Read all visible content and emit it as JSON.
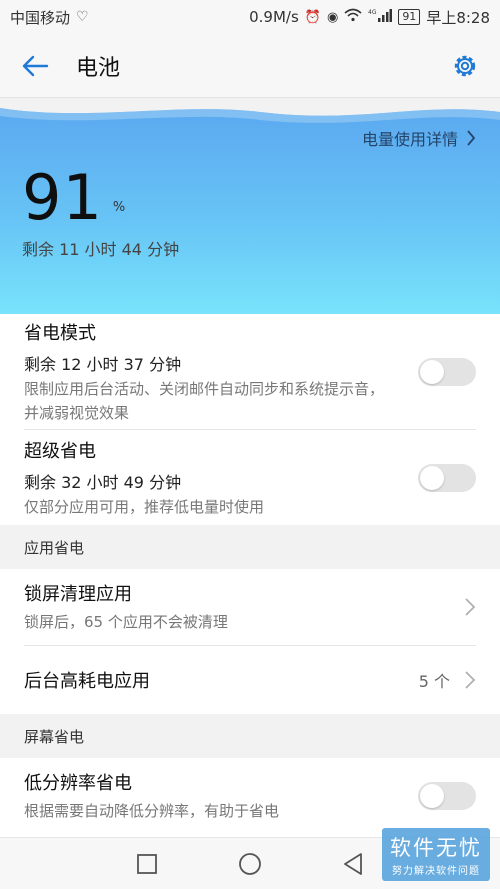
{
  "status_bar": {
    "carrier": "中国移动",
    "speed": "0.9M/s",
    "signal_label": "4G",
    "battery": "91",
    "time": "早上8:28"
  },
  "header": {
    "title": "电池"
  },
  "hero": {
    "detail_link": "电量使用详情",
    "percent": "91",
    "percent_sign": "%",
    "remaining": "剩余 11 小时 44 分钟"
  },
  "modes": [
    {
      "title": "省电模式",
      "remaining": "剩余 12 小时 37 分钟",
      "description": "限制应用后台活动、关闭邮件自动同步和系统提示音，并减弱视觉效果",
      "enabled": false
    },
    {
      "title": "超级省电",
      "remaining": "剩余 32 小时 49 分钟",
      "description": "仅部分应用可用，推荐低电量时使用",
      "enabled": false
    }
  ],
  "app_saving": {
    "section_title": "应用省电",
    "items": [
      {
        "title": "锁屏清理应用",
        "description": "锁屏后，65 个应用不会被清理"
      },
      {
        "title": "后台高耗电应用",
        "value": "5 个"
      }
    ]
  },
  "screen_saving": {
    "section_title": "屏幕省电",
    "items": [
      {
        "title": "低分辨率省电",
        "description": "根据需要自动降低分辨率，有助于省电",
        "enabled": false
      }
    ]
  },
  "watermark": {
    "main": "软件无忧",
    "sub": "努力解决软件问题"
  },
  "colors": {
    "accent": "#1e7ad6",
    "hero_top": "#5aa6f0",
    "hero_bottom": "#78e3fb"
  }
}
